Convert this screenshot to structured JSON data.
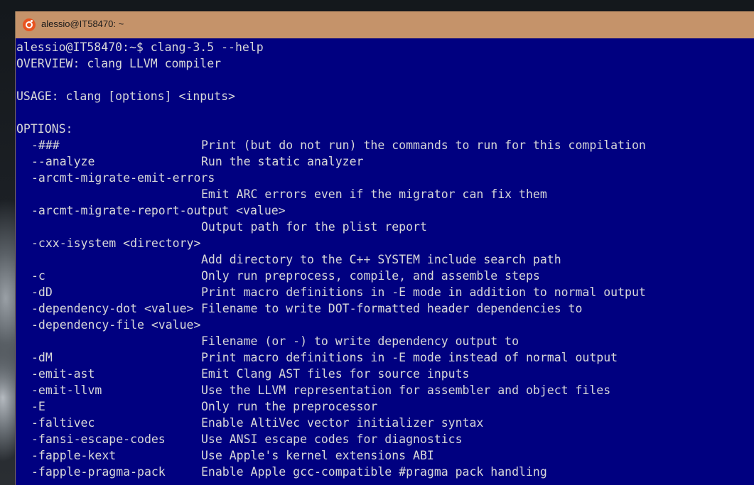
{
  "window": {
    "title": "alessio@IT58470: ~",
    "icon": "ubuntu-logo-icon"
  },
  "terminal": {
    "prompt": "alessio@IT58470:~$ clang-3.5 --help",
    "overview": "OVERVIEW: clang LLVM compiler",
    "usage": "USAGE: clang [options] <inputs>",
    "options_header": "OPTIONS:",
    "options": [
      {
        "flag": "-###",
        "desc": "Print (but do not run) the commands to run for this compilation"
      },
      {
        "flag": "--analyze",
        "desc": "Run the static analyzer"
      },
      {
        "flag": "-arcmt-migrate-emit-errors",
        "desc": ""
      },
      {
        "flag": "",
        "desc": "Emit ARC errors even if the migrator can fix them"
      },
      {
        "flag": "-arcmt-migrate-report-output <value>",
        "desc": ""
      },
      {
        "flag": "",
        "desc": "Output path for the plist report"
      },
      {
        "flag": "-cxx-isystem <directory>",
        "desc": ""
      },
      {
        "flag": "",
        "desc": "Add directory to the C++ SYSTEM include search path"
      },
      {
        "flag": "-c",
        "desc": "Only run preprocess, compile, and assemble steps"
      },
      {
        "flag": "-dD",
        "desc": "Print macro definitions in -E mode in addition to normal output"
      },
      {
        "flag": "-dependency-dot <value>",
        "desc": "Filename to write DOT-formatted header dependencies to"
      },
      {
        "flag": "-dependency-file <value>",
        "desc": ""
      },
      {
        "flag": "",
        "desc": "Filename (or -) to write dependency output to"
      },
      {
        "flag": "-dM",
        "desc": "Print macro definitions in -E mode instead of normal output"
      },
      {
        "flag": "-emit-ast",
        "desc": "Emit Clang AST files for source inputs"
      },
      {
        "flag": "-emit-llvm",
        "desc": "Use the LLVM representation for assembler and object files"
      },
      {
        "flag": "-E",
        "desc": "Only run the preprocessor"
      },
      {
        "flag": "-faltivec",
        "desc": "Enable AltiVec vector initializer syntax"
      },
      {
        "flag": "-fansi-escape-codes",
        "desc": "Use ANSI escape codes for diagnostics"
      },
      {
        "flag": "-fapple-kext",
        "desc": "Use Apple's kernel extensions ABI"
      },
      {
        "flag": "-fapple-pragma-pack",
        "desc": "Enable Apple gcc-compatible #pragma pack handling"
      }
    ]
  },
  "colors": {
    "terminal_bg": "#000080",
    "terminal_fg": "#d8d8d8",
    "titlebar_bg": "#c5936a"
  }
}
